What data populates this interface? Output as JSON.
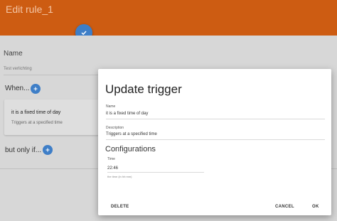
{
  "header": {
    "title": "Edit rule_1"
  },
  "rule": {
    "name_label": "Name",
    "name_value": "Test verlichting",
    "when_label": "When...",
    "trigger_card": {
      "title": "it is a fixed time of day",
      "subtitle": "Triggers at a specified time"
    },
    "butonlyif_label": "but only if..."
  },
  "dialog": {
    "title": "Update trigger",
    "name_label": "Name",
    "name_value": "it is a fixed time of day",
    "description_label": "Description",
    "description_value": "Triggers at a specified time",
    "configurations_title": "Configurations",
    "time_label": "Time",
    "time_value": "22:46",
    "time_hint": "the time (in hh:mm)",
    "delete_label": "DELETE",
    "cancel_label": "CANCEL",
    "ok_label": "OK"
  },
  "colors": {
    "header": "#cd5c12",
    "accent": "#3e7ec7"
  },
  "icons": {
    "save": "check-icon",
    "add": "plus-icon"
  }
}
